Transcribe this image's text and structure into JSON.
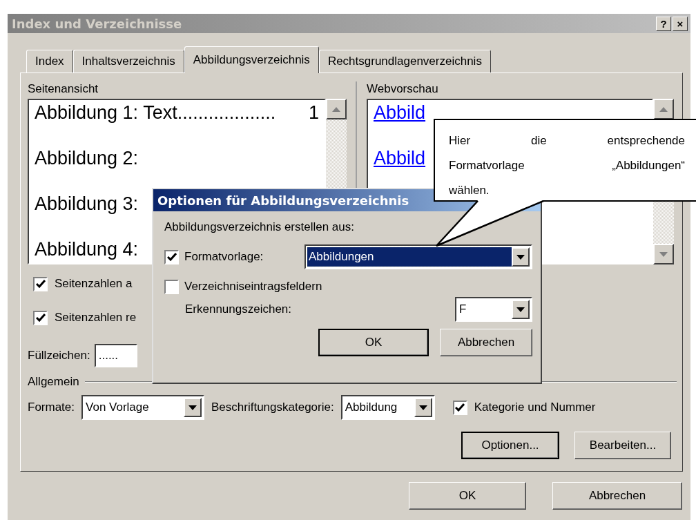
{
  "window": {
    "title": "Index und Verzeichnisse",
    "help_button": "?",
    "close_button": "×"
  },
  "tabs": [
    {
      "label": "Index",
      "selected": false
    },
    {
      "label": "Inhaltsverzeichnis",
      "selected": false
    },
    {
      "label": "Abbildungsverzeichnis",
      "selected": true
    },
    {
      "label": "Rechtsgrundlagenverzeichnis",
      "selected": false
    }
  ],
  "page_preview": {
    "label": "Seitenansicht",
    "entries": [
      {
        "text": "Abbildung 1: Text",
        "leader": "...................",
        "page": "1"
      },
      {
        "text": "Abbildung 2:"
      },
      {
        "text": "Abbildung 3:"
      },
      {
        "text": "Abbildung 4:"
      }
    ]
  },
  "web_preview": {
    "label": "Webvorschau",
    "entries": [
      "Abbild",
      "Abbild"
    ]
  },
  "page_options": [
    {
      "label": "Seitenzahlen a",
      "checked": true
    },
    {
      "label": "Seitenzahlen re",
      "checked": true
    }
  ],
  "fill_char": {
    "label": "Füllzeichen:",
    "value": "......"
  },
  "general": {
    "label": "Allgemein",
    "formats": {
      "label": "Formate:",
      "value": "Von Vorlage"
    },
    "caption": {
      "label": "Beschriftungskategorie:",
      "value": "Abbildung"
    },
    "include": {
      "label": "Kategorie und Nummer",
      "checked": true
    }
  },
  "panel_buttons": [
    "Optionen...",
    "Bearbeiten..."
  ],
  "dialog_buttons": [
    "OK",
    "Abbrechen"
  ],
  "options_dialog": {
    "title": "Optionen für Abbildungsverzeichnis",
    "intro": "Abbildungsverzeichnis erstellen aus:",
    "style": {
      "label": "Formatvorlage:",
      "checked": true,
      "value": "Abbildungen",
      "highlighted": true
    },
    "fields": {
      "label": "Verzeichniseintragsfeldern",
      "checked": false
    },
    "identifier": {
      "label": "Erkennungszeichen:",
      "value": "F"
    },
    "buttons": [
      "OK",
      "Abbrechen"
    ]
  },
  "callout": {
    "lines": [
      "Hier die entsprechende",
      "Formatvorlage „Abbildungen“",
      "wählen."
    ]
  }
}
